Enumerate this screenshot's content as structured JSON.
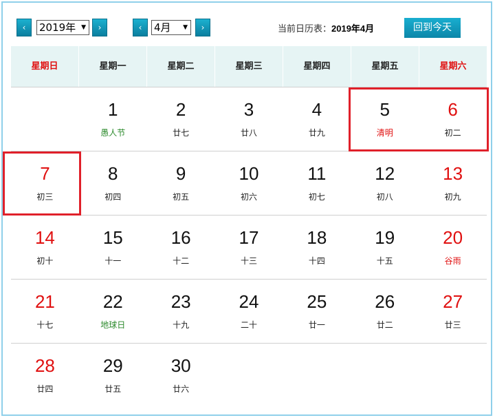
{
  "toolbar": {
    "prev_year_icon": "‹",
    "year_value": "2019年",
    "next_year_icon": "›",
    "prev_month_icon": "‹",
    "month_value": "4月",
    "next_month_icon": "›",
    "current_label": "当前日历表：",
    "current_value": "2019年4月",
    "today_button": "回到今天"
  },
  "weekdays": [
    "星期日",
    "星期一",
    "星期二",
    "星期三",
    "星期四",
    "星期五",
    "星期六"
  ],
  "colors": {
    "accent": "#0c86a8",
    "weekend": "#e01010",
    "festival": "#2c8a2c",
    "highlight": "#e0202a",
    "header_bg": "#e6f4f4"
  },
  "weeks": [
    [
      null,
      {
        "day": "1",
        "lunar": "愚人节",
        "lunar_color": "green"
      },
      {
        "day": "2",
        "lunar": "廿七"
      },
      {
        "day": "3",
        "lunar": "廿八"
      },
      {
        "day": "4",
        "lunar": "廿九"
      },
      {
        "day": "5",
        "lunar": "清明",
        "lunar_color": "red",
        "highlighted": true
      },
      {
        "day": "6",
        "lunar": "初二",
        "red": true,
        "highlighted": true
      }
    ],
    [
      {
        "day": "7",
        "lunar": "初三",
        "red": true,
        "highlighted": true
      },
      {
        "day": "8",
        "lunar": "初四"
      },
      {
        "day": "9",
        "lunar": "初五"
      },
      {
        "day": "10",
        "lunar": "初六"
      },
      {
        "day": "11",
        "lunar": "初七"
      },
      {
        "day": "12",
        "lunar": "初八"
      },
      {
        "day": "13",
        "lunar": "初九",
        "red": true
      }
    ],
    [
      {
        "day": "14",
        "lunar": "初十",
        "red": true
      },
      {
        "day": "15",
        "lunar": "十一"
      },
      {
        "day": "16",
        "lunar": "十二"
      },
      {
        "day": "17",
        "lunar": "十三"
      },
      {
        "day": "18",
        "lunar": "十四"
      },
      {
        "day": "19",
        "lunar": "十五"
      },
      {
        "day": "20",
        "lunar": "谷雨",
        "red": true,
        "lunar_color": "red"
      }
    ],
    [
      {
        "day": "21",
        "lunar": "十七",
        "red": true
      },
      {
        "day": "22",
        "lunar": "地球日",
        "lunar_color": "green"
      },
      {
        "day": "23",
        "lunar": "十九"
      },
      {
        "day": "24",
        "lunar": "二十"
      },
      {
        "day": "25",
        "lunar": "廿一"
      },
      {
        "day": "26",
        "lunar": "廿二"
      },
      {
        "day": "27",
        "lunar": "廿三",
        "red": true
      }
    ],
    [
      {
        "day": "28",
        "lunar": "廿四",
        "red": true
      },
      {
        "day": "29",
        "lunar": "廿五"
      },
      {
        "day": "30",
        "lunar": "廿六"
      },
      null,
      null,
      null,
      null
    ]
  ]
}
